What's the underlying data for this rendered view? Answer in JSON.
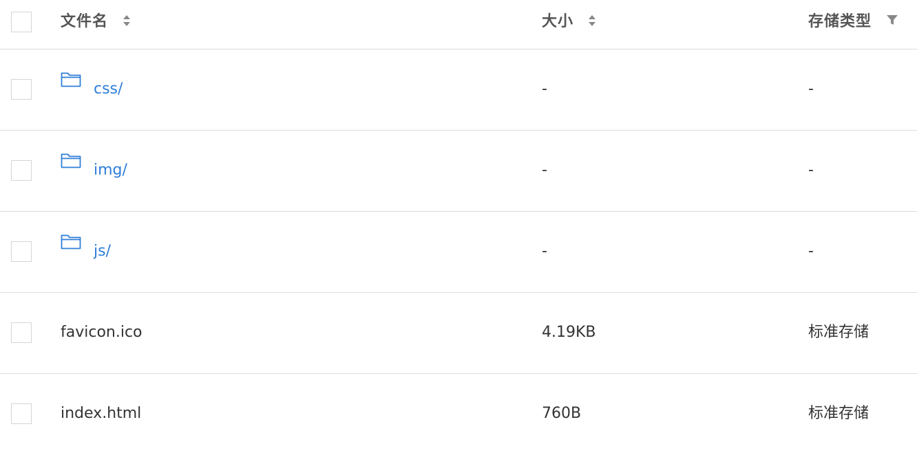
{
  "header": {
    "name_label": "文件名",
    "size_label": "大小",
    "type_label": "存储类型",
    "icons": {
      "name_sort": "sort-icon",
      "size_sort": "sort-icon",
      "type_filter": "filter-icon"
    }
  },
  "rows": [
    {
      "name": "css/",
      "size": "-",
      "type": "-",
      "is_folder": true,
      "icon": "folder-icon"
    },
    {
      "name": "img/",
      "size": "-",
      "type": "-",
      "is_folder": true,
      "icon": "folder-icon"
    },
    {
      "name": "js/",
      "size": "-",
      "type": "-",
      "is_folder": true,
      "icon": "folder-icon"
    },
    {
      "name": "favicon.ico",
      "size": "4.19KB",
      "type": "标准存储",
      "is_folder": false
    },
    {
      "name": "index.html",
      "size": "760B",
      "type": "标准存储",
      "is_folder": false
    }
  ],
  "colors": {
    "folder_link": "#2f7ed8",
    "text": "#333333",
    "header_text": "#555555",
    "divider": "#dcdcdc",
    "icon_gray": "#888888"
  }
}
